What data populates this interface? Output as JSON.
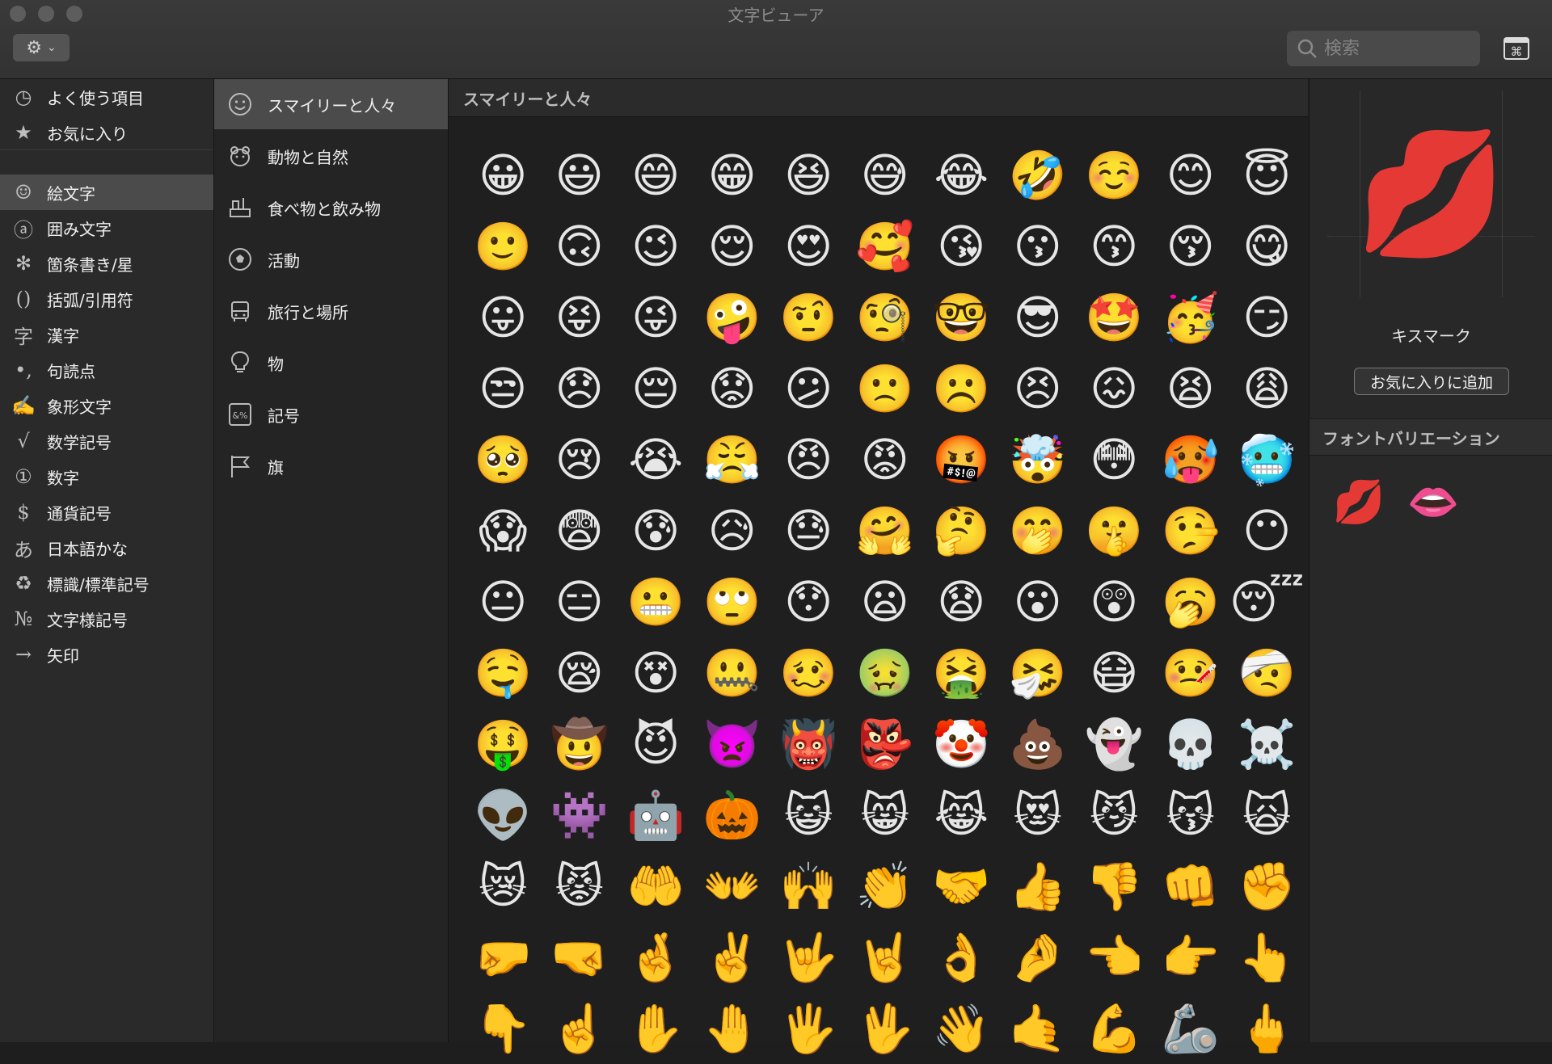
{
  "window": {
    "title": "文字ビューア"
  },
  "toolbar": {
    "action_icon": "gear-icon",
    "search_placeholder": "検索"
  },
  "sidebar": {
    "items": [
      {
        "icon": "◷",
        "label": "よく使う項目"
      },
      {
        "icon": "★",
        "label": "お気に入り"
      },
      {
        "icon": "☺",
        "label": "絵文字"
      },
      {
        "icon": "ⓐ",
        "label": "囲み文字"
      },
      {
        "icon": "✻",
        "label": "箇条書き/星"
      },
      {
        "icon": "()",
        "label": "括弧/引用符"
      },
      {
        "icon": "字",
        "label": "漢字"
      },
      {
        "icon": "•,",
        "label": "句読点"
      },
      {
        "icon": "✍",
        "label": "象形文字"
      },
      {
        "icon": "√",
        "label": "数学記号"
      },
      {
        "icon": "①",
        "label": "数字"
      },
      {
        "icon": "$",
        "label": "通貨記号"
      },
      {
        "icon": "あ",
        "label": "日本語かな"
      },
      {
        "icon": "♻",
        "label": "標識/標準記号"
      },
      {
        "icon": "№",
        "label": "文字様記号"
      },
      {
        "icon": "→",
        "label": "矢印"
      }
    ],
    "selected": "絵文字"
  },
  "subcategories": {
    "items": [
      {
        "label": "スマイリーと人々"
      },
      {
        "label": "動物と自然"
      },
      {
        "label": "食べ物と飲み物"
      },
      {
        "label": "活動"
      },
      {
        "label": "旅行と場所"
      },
      {
        "label": "物"
      },
      {
        "label": "記号"
      },
      {
        "label": "旗"
      }
    ],
    "selected": "スマイリーと人々"
  },
  "main": {
    "section_title": "スマイリーと人々",
    "emojis": [
      "😀",
      "😃",
      "😄",
      "😁",
      "😆",
      "😅",
      "😂",
      "🤣",
      "☺️",
      "😊",
      "😇",
      "🙂",
      "🙃",
      "😉",
      "😌",
      "😍",
      "🥰",
      "😘",
      "😗",
      "😙",
      "😚",
      "😋",
      "😛",
      "😝",
      "😜",
      "🤪",
      "🤨",
      "🧐",
      "🤓",
      "😎",
      "🤩",
      "🥳",
      "😏",
      "😒",
      "😞",
      "😔",
      "😟",
      "😕",
      "🙁",
      "☹️",
      "😣",
      "😖",
      "😫",
      "😩",
      "🥺",
      "😢",
      "😭",
      "😤",
      "😠",
      "😡",
      "🤬",
      "🤯",
      "😳",
      "🥵",
      "🥶",
      "😱",
      "😨",
      "😰",
      "😥",
      "😓",
      "🤗",
      "🤔",
      "🤭",
      "🤫",
      "🤥",
      "😶",
      "😐",
      "😑",
      "😬",
      "🙄",
      "😯",
      "😦",
      "😧",
      "😮",
      "😲",
      "🥱",
      "😴",
      "🤤",
      "😪",
      "😵",
      "🤐",
      "🥴",
      "🤢",
      "🤮",
      "🤧",
      "😷",
      "🤒",
      "🤕",
      "🤑",
      "🤠",
      "😈",
      "👿",
      "👹",
      "👺",
      "🤡",
      "💩",
      "👻",
      "💀",
      "☠️",
      "👽",
      "👾",
      "🤖",
      "🎃",
      "😺",
      "😸",
      "😹",
      "😻",
      "😼",
      "😽",
      "🙀",
      "😿",
      "😾",
      "🤲",
      "👐",
      "🙌",
      "👏",
      "🤝",
      "👍",
      "👎",
      "👊",
      "✊",
      "🤛",
      "🤜",
      "🤞",
      "✌️",
      "🤟",
      "🤘",
      "👌",
      "🤌",
      "👈",
      "👉",
      "👆",
      "👇",
      "☝️",
      "✋",
      "🤚",
      "🖐",
      "🖖",
      "👋",
      "🤙",
      "💪",
      "🦾",
      "🖕"
    ]
  },
  "inspector": {
    "preview_glyph": "💋",
    "character_name": "キスマーク",
    "add_favorite_label": "お気に入りに追加",
    "variations_title": "フォントバリエーション",
    "variations": [
      "💋",
      "👄"
    ]
  }
}
